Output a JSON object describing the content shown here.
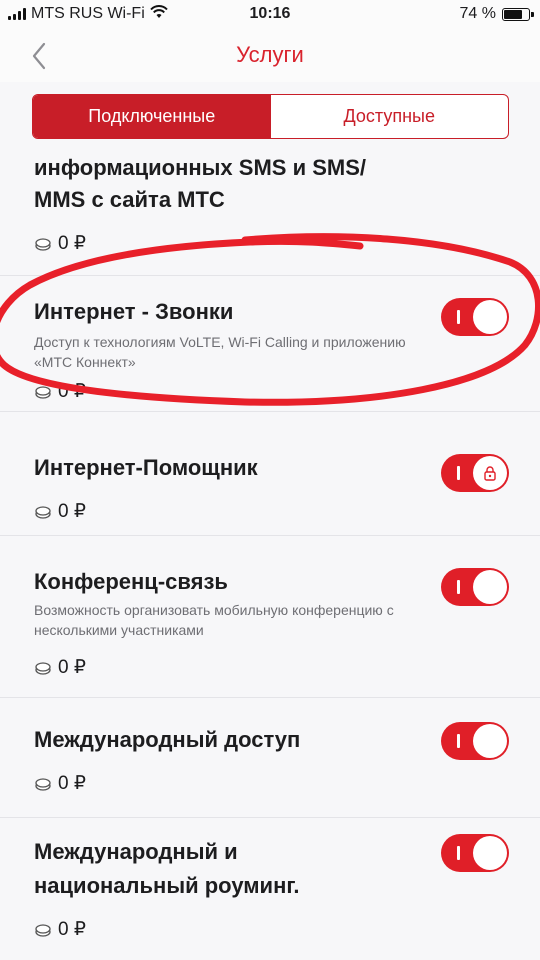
{
  "status_bar": {
    "carrier": "MTS RUS Wi-Fi",
    "time": "10:16",
    "battery_percent": "74 %",
    "battery_level": 0.74
  },
  "nav": {
    "title": "Услуги",
    "back_icon": "chevron-left-icon"
  },
  "tabs": [
    {
      "label": "Подключенные",
      "active": true
    },
    {
      "label": "Доступные",
      "active": false
    }
  ],
  "services": [
    {
      "title_lines": [
        "информационных SMS и SMS/",
        "MMS с сайта МТС"
      ],
      "description": "",
      "price": "0 ₽",
      "toggle": false,
      "locked": false
    },
    {
      "title_lines": [
        "Интернет - Звонки"
      ],
      "description": "Доступ к технологиям VoLTE, Wi-Fi Calling и приложению «МТС Коннект»",
      "price": "0 ₽",
      "toggle": true,
      "locked": false
    },
    {
      "title_lines": [
        "Интернет-Помощник"
      ],
      "description": "",
      "price": "0 ₽",
      "toggle": true,
      "locked": true
    },
    {
      "title_lines": [
        "Конференц-связь"
      ],
      "description": "Возможность организовать мобильную конференцию с несколькими участниками",
      "price": "0 ₽",
      "toggle": true,
      "locked": false
    },
    {
      "title_lines": [
        "Международный доступ"
      ],
      "description": "",
      "price": "0 ₽",
      "toggle": true,
      "locked": false
    },
    {
      "title_lines": [
        "Международный и",
        "национальный роуминг."
      ],
      "description": "",
      "price": "0 ₽",
      "toggle": true,
      "locked": false
    }
  ],
  "colors": {
    "brand_red": "#e01f28",
    "annotation_red": "#e8202a"
  }
}
